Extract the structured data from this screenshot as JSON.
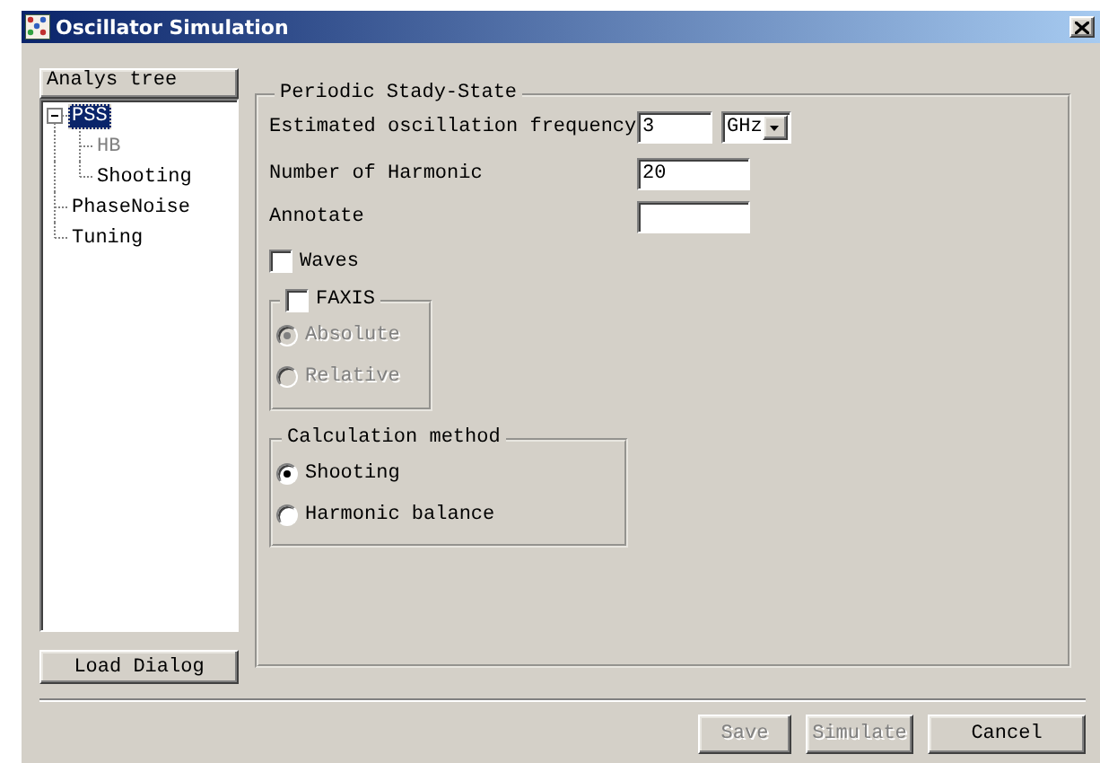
{
  "window": {
    "title": "Oscillator Simulation"
  },
  "tree": {
    "header": "Analys tree",
    "items": [
      {
        "label": "PSS",
        "selected": true,
        "expanded": true,
        "disabled": false,
        "children": [
          {
            "label": "HB",
            "selected": false,
            "disabled": true
          },
          {
            "label": "Shooting",
            "selected": false,
            "disabled": false
          }
        ]
      },
      {
        "label": "PhaseNoise",
        "selected": false,
        "disabled": false
      },
      {
        "label": "Tuning",
        "selected": false,
        "disabled": false
      }
    ]
  },
  "load_button": {
    "label": "Load Dialog"
  },
  "pss": {
    "title": "Periodic Stady-State",
    "frequency": {
      "label": "Estimated oscillation frequency",
      "value": "3",
      "unit": "GHz"
    },
    "harmonics": {
      "label": "Number of Harmonic",
      "value": "20"
    },
    "annotate": {
      "label": "Annotate"
    },
    "waves": {
      "label": "Waves",
      "checked": false
    },
    "faxis": {
      "label": "FAXIS",
      "checked": false,
      "options": [
        {
          "label": "Absolute",
          "selected": true,
          "disabled": true
        },
        {
          "label": "Relative",
          "selected": false,
          "disabled": true
        }
      ]
    },
    "calculation": {
      "title": "Calculation method",
      "options": [
        {
          "label": "Shooting",
          "selected": true,
          "disabled": false
        },
        {
          "label": "Harmonic balance",
          "selected": false,
          "disabled": false
        }
      ]
    }
  },
  "buttons": [
    {
      "label": "Save",
      "disabled": true
    },
    {
      "label": "Simulate",
      "disabled": true
    },
    {
      "label": "Cancel",
      "disabled": false
    }
  ]
}
